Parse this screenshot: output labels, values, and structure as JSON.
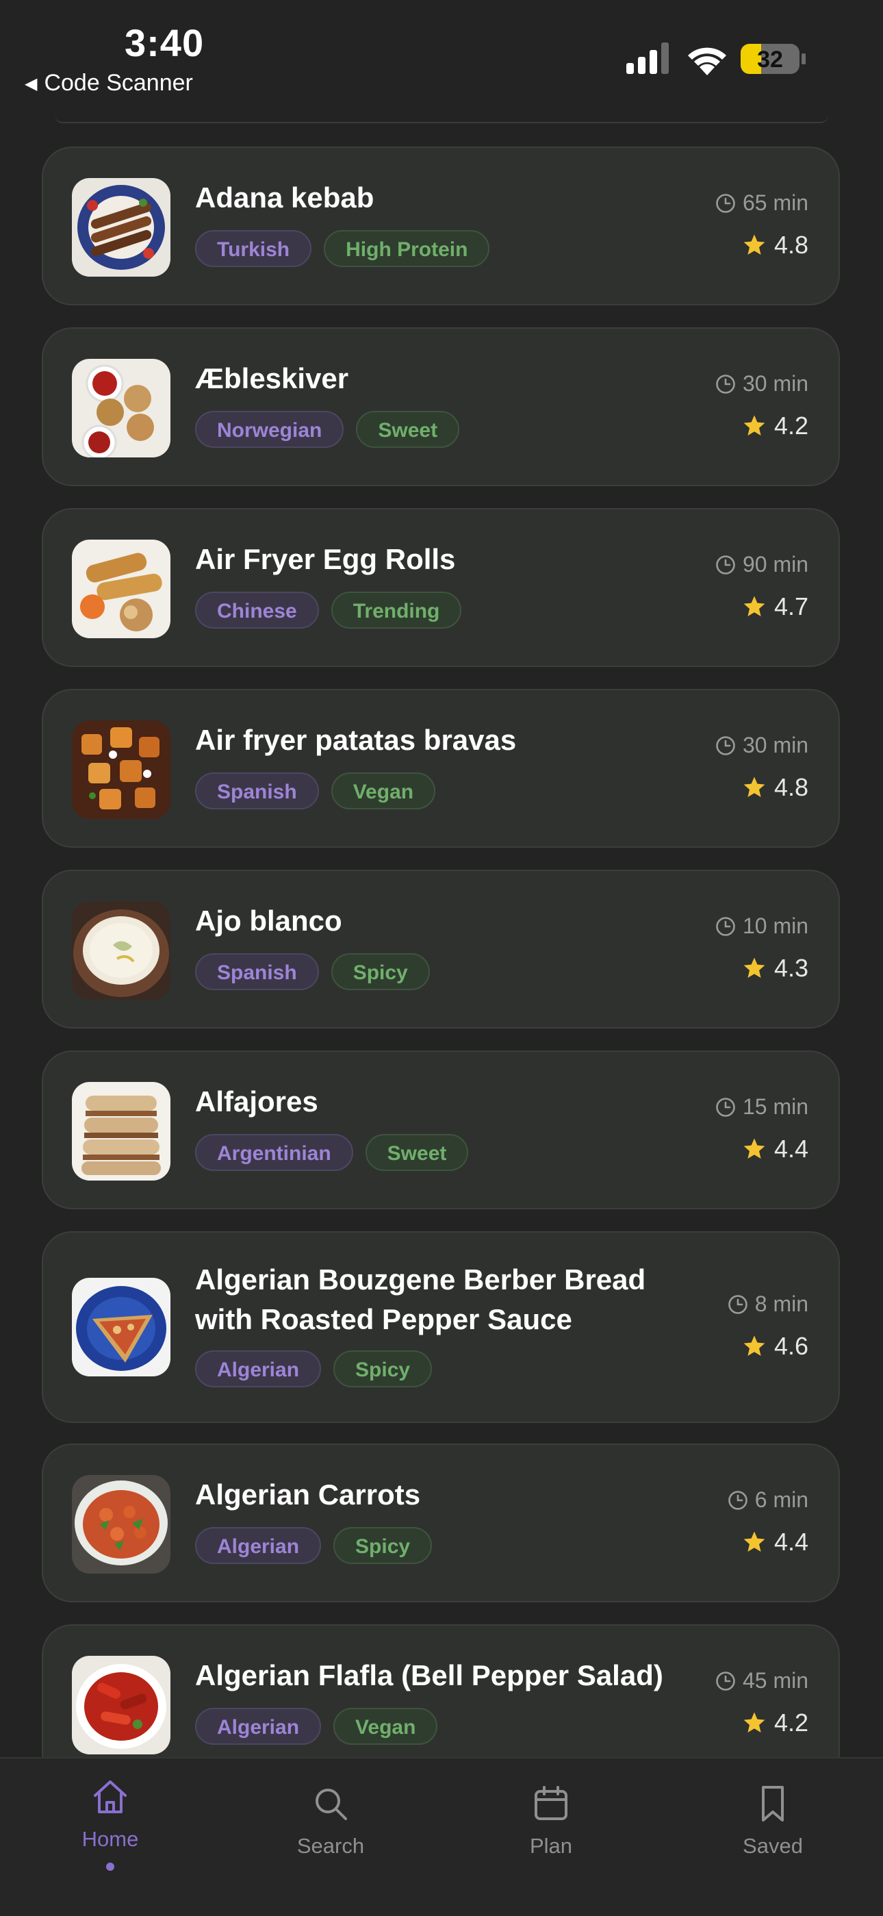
{
  "status_bar": {
    "time": "3:40",
    "back_app": "Code Scanner",
    "battery": "32"
  },
  "recipes": [
    {
      "title": "Adana kebab",
      "cuisine": "Turkish",
      "tag": "High Protein",
      "duration": "65 min",
      "rating": "4.8"
    },
    {
      "title": "Æbleskiver",
      "cuisine": "Norwegian",
      "tag": "Sweet",
      "duration": "30 min",
      "rating": "4.2"
    },
    {
      "title": "Air Fryer Egg Rolls",
      "cuisine": "Chinese",
      "tag": "Trending",
      "duration": "90 min",
      "rating": "4.7"
    },
    {
      "title": "Air fryer patatas bravas",
      "cuisine": "Spanish",
      "tag": "Vegan",
      "duration": "30 min",
      "rating": "4.8"
    },
    {
      "title": "Ajo blanco",
      "cuisine": "Spanish",
      "tag": "Spicy",
      "duration": "10 min",
      "rating": "4.3"
    },
    {
      "title": "Alfajores",
      "cuisine": "Argentinian",
      "tag": "Sweet",
      "duration": "15 min",
      "rating": "4.4"
    },
    {
      "title_line1": "Algerian Bouzgene Berber Bread",
      "title_line2": "with Roasted Pepper Sauce",
      "cuisine": "Algerian",
      "tag": "Spicy",
      "duration": "8 min",
      "rating": "4.6"
    },
    {
      "title": "Algerian Carrots",
      "cuisine": "Algerian",
      "tag": "Spicy",
      "duration": "6 min",
      "rating": "4.4"
    },
    {
      "title": "Algerian Flafla (Bell Pepper Salad)",
      "cuisine": "Algerian",
      "tag": "Vegan",
      "duration": "45 min",
      "rating": "4.2"
    }
  ],
  "tabs": [
    {
      "label": "Home",
      "icon": "home-icon",
      "active": true
    },
    {
      "label": "Search",
      "icon": "search-icon"
    },
    {
      "label": "Plan",
      "icon": "calendar-icon"
    },
    {
      "label": "Saved",
      "icon": "bookmark-icon"
    }
  ],
  "colors": {
    "accent": "#8a6fd0",
    "diet_tag": "#70b06b",
    "star": "#f4c430",
    "battery": "#f2d000"
  }
}
